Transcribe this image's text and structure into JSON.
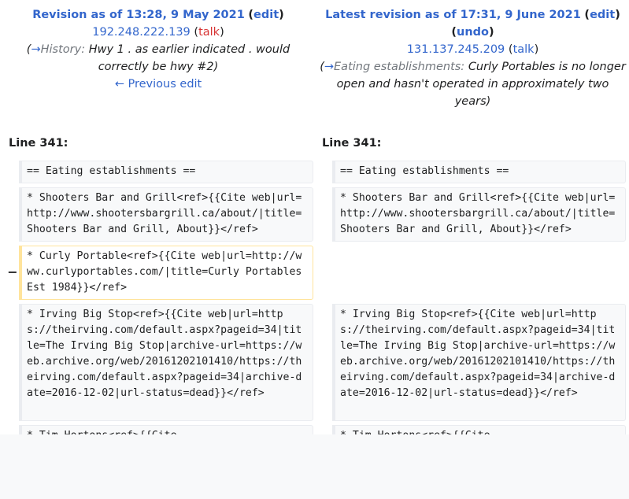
{
  "left": {
    "title": "Revision as of 13:28, 9 May 2021",
    "edit": "edit",
    "user": "192.248.222.139",
    "talk": "talk",
    "summary_section": "History:",
    "summary_text": "Hwy 1 . as earlier indicated . would correctly be hwy #2)",
    "prev": "← Previous edit",
    "line": "Line 341:"
  },
  "right": {
    "title": "Latest revision as of 17:31, 9 June 2021",
    "edit": "edit",
    "undo": "undo",
    "user": "131.137.245.209",
    "talk": "talk",
    "summary_section": "Eating establishments:",
    "summary_text": "Curly Portables is no longer open and hasn't operated in approximately two years)",
    "line": "Line 341:"
  },
  "diff": {
    "marker": "−",
    "l1": "== Eating establishments ==",
    "l2": "* Shooters Bar and Grill<ref>{{Cite web|url=http://www.shootersbargrill.ca/about/|title=Shooters Bar and Grill, About}}</ref>",
    "l3": "* Curly Portable<ref>{{Cite web|url=http://www.curlyportables.com/|title=Curly Portables Est 1984}}</ref>",
    "l4": "* Irving Big Stop<ref>{{Cite web|url=https://theirving.com/default.aspx?pageid=34|title=The Irving Big Stop|archive-url=https://web.archive.org/web/20161202101410/https://theirving.com/default.aspx?pageid=34|archive-date=2016-12-02|url-status=dead}}</ref>",
    "l5": "* Tim Hortons<ref>{{Cite"
  }
}
